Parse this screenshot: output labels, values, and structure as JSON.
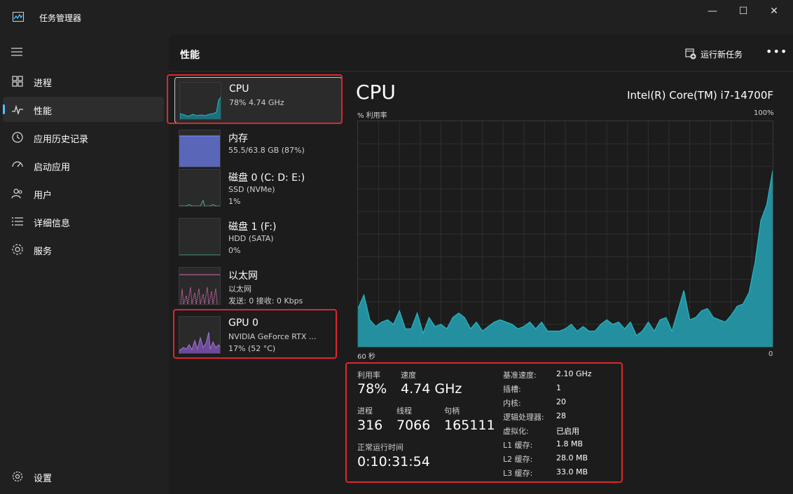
{
  "window": {
    "title": "任务管理器",
    "minimize_glyph": "—",
    "maximize_glyph": "☐",
    "close_glyph": "✕"
  },
  "sidebar": {
    "items": [
      {
        "label": "进程",
        "icon": "processes-icon"
      },
      {
        "label": "性能",
        "icon": "performance-icon",
        "active": true
      },
      {
        "label": "应用历史记录",
        "icon": "history-icon"
      },
      {
        "label": "启动应用",
        "icon": "startup-icon"
      },
      {
        "label": "用户",
        "icon": "users-icon"
      },
      {
        "label": "详细信息",
        "icon": "details-icon"
      },
      {
        "label": "服务",
        "icon": "services-icon"
      }
    ],
    "settings_label": "设置"
  },
  "header": {
    "title": "性能",
    "run_task_label": "运行新任务",
    "more_label": "•••"
  },
  "resources": [
    {
      "name": "CPU",
      "line1": "78% 4.74 GHz",
      "line2": "",
      "color": "#29b6c4"
    },
    {
      "name": "内存",
      "line1": "55.5/63.8 GB (87%)",
      "line2": "",
      "color": "#6f7fd8"
    },
    {
      "name": "磁盘 0 (C: D: E:)",
      "line1": "SSD (NVMe)",
      "line2": "1%",
      "color": "#3fbf7f"
    },
    {
      "name": "磁盘 1 (F:)",
      "line1": "HDD (SATA)",
      "line2": "0%",
      "color": "#3fbf7f"
    },
    {
      "name": "以太网",
      "line1": "以太网",
      "line2": "发送: 0 接收: 0 Kbps",
      "color": "#d66bb8"
    },
    {
      "name": "GPU 0",
      "line1": "NVIDIA GeForce RTX ...",
      "line2": "17% (52 °C)",
      "color": "#a077d6"
    }
  ],
  "cpu": {
    "title": "CPU",
    "model": "Intel(R) Core(TM) i7-14700F",
    "y_label": "% 利用率",
    "y_max_label": "100%",
    "x_left_label": "60 秒",
    "x_right_label": "0",
    "stats": {
      "utilization_label": "利用率",
      "utilization": "78%",
      "speed_label": "速度",
      "speed": "4.74 GHz",
      "processes_label": "进程",
      "processes": "316",
      "threads_label": "线程",
      "threads": "7066",
      "handles_label": "句柄",
      "handles": "165111",
      "uptime_label": "正常运行时间",
      "uptime": "0:10:31:54"
    },
    "specs": [
      {
        "label": "基准速度:",
        "value": "2.10 GHz"
      },
      {
        "label": "插槽:",
        "value": "1"
      },
      {
        "label": "内核:",
        "value": "20"
      },
      {
        "label": "逻辑处理器:",
        "value": "28"
      },
      {
        "label": "虚拟化:",
        "value": "已启用"
      },
      {
        "label": "L1 缓存:",
        "value": "1.8 MB"
      },
      {
        "label": "L2 缓存:",
        "value": "28.0 MB"
      },
      {
        "label": "L3 缓存:",
        "value": "33.0 MB"
      }
    ],
    "history": [
      17,
      23,
      12,
      9,
      11,
      12,
      10,
      16,
      8,
      8,
      15,
      6,
      13,
      9,
      10,
      8,
      13,
      15,
      13,
      8,
      11,
      7,
      9,
      11,
      12,
      11,
      10,
      8,
      9,
      11,
      8,
      11,
      7,
      7,
      7,
      8,
      10,
      7,
      9,
      7,
      7,
      10,
      12,
      10,
      11,
      8,
      11,
      5,
      7,
      11,
      7,
      12,
      13,
      7,
      16,
      25,
      12,
      13,
      16,
      17,
      13,
      12,
      11,
      14,
      18,
      19,
      24,
      37,
      56,
      63,
      78
    ]
  },
  "colors": {
    "accent": "#4cc2ff",
    "highlight": "#e0262b",
    "cpu_line": "#29b6c4",
    "cpu_fill": "#26a3b5"
  }
}
